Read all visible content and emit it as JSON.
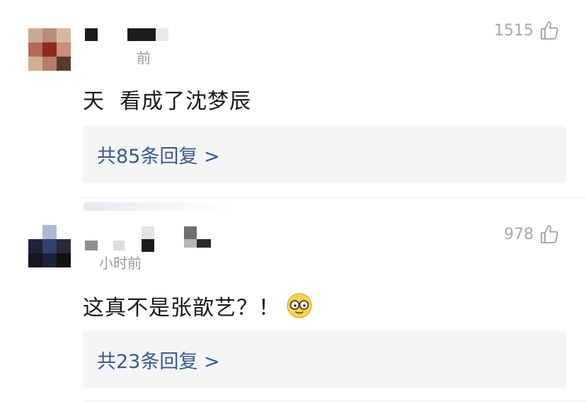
{
  "comments": [
    {
      "time_ago": "前",
      "likes": "1515",
      "text": "天  看成了沈梦辰",
      "replies_label": "共85条回复 >",
      "icons": {
        "like": "thumbs-up-icon"
      }
    },
    {
      "time_ago": "小时前",
      "likes": "978",
      "text": "这真不是张歆艺？！",
      "replies_label": "共23条回复 >",
      "icons": {
        "like": "thumbs-up-icon",
        "emoji": "nerd-glasses-emoji-icon"
      }
    }
  ],
  "colors": {
    "reply_link": "#3b5a8a",
    "reply_bg": "#f4f5f7",
    "muted": "#9a9a9a"
  }
}
